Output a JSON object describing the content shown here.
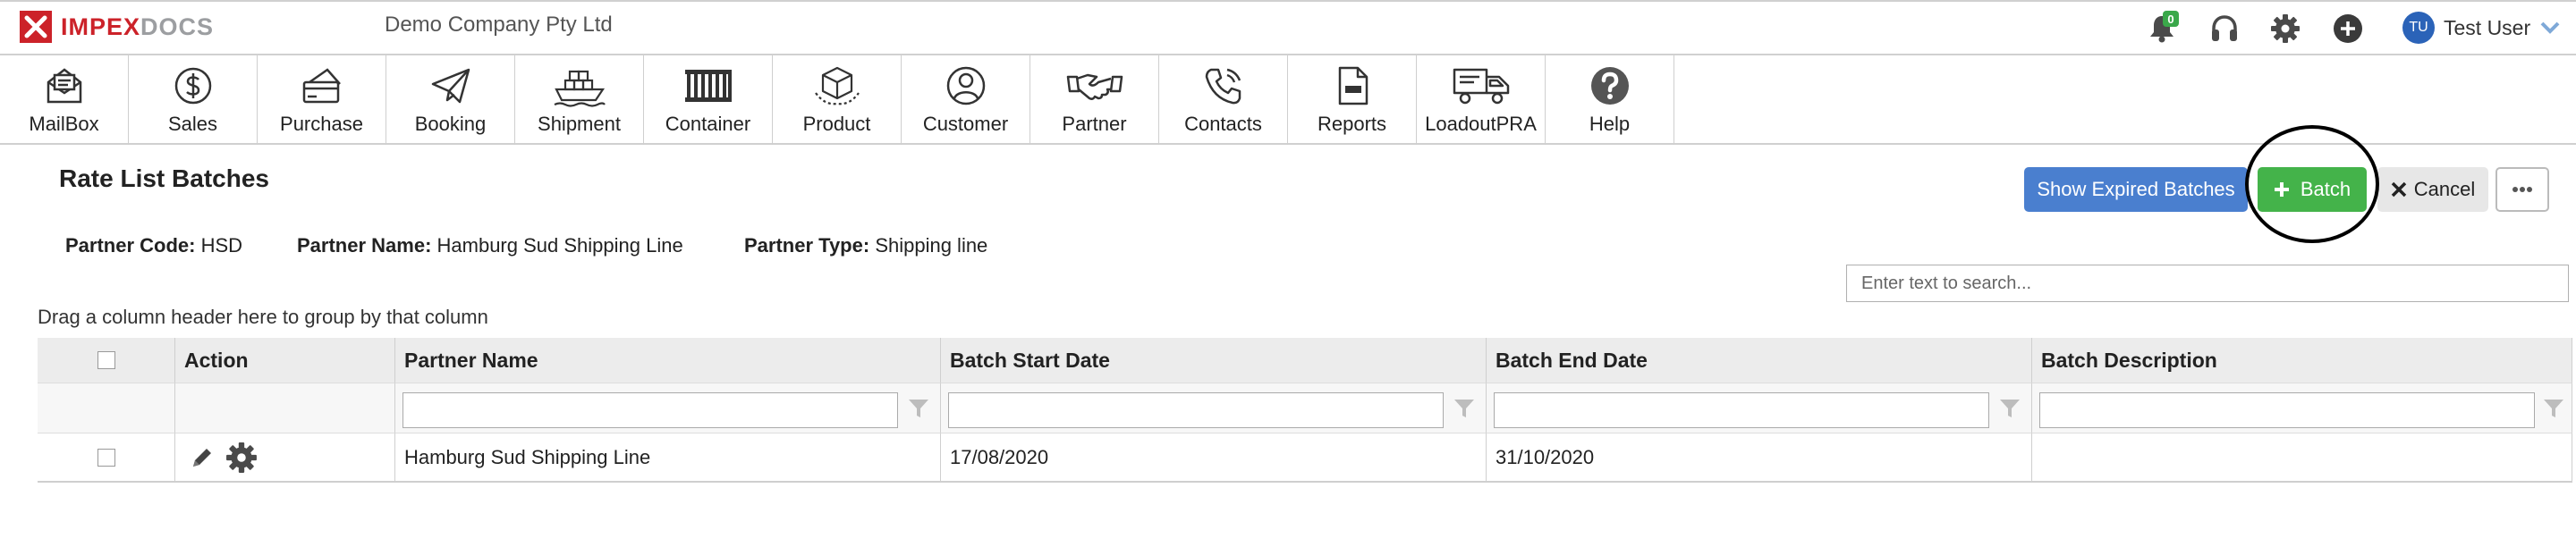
{
  "header": {
    "logo_a": "IMPEX",
    "logo_b": "DOCS",
    "company": "Demo Company Pty Ltd",
    "notification_count": "0",
    "user_initials": "TU",
    "user_name": "Test User"
  },
  "modules": [
    {
      "label": "MailBox",
      "icon": "mailbox-icon"
    },
    {
      "label": "Sales",
      "icon": "dollar-icon"
    },
    {
      "label": "Purchase",
      "icon": "purchase-icon"
    },
    {
      "label": "Booking",
      "icon": "paper-plane-icon"
    },
    {
      "label": "Shipment",
      "icon": "ship-icon"
    },
    {
      "label": "Container",
      "icon": "container-icon"
    },
    {
      "label": "Product",
      "icon": "box-icon"
    },
    {
      "label": "Customer",
      "icon": "customer-icon"
    },
    {
      "label": "Partner",
      "icon": "handshake-icon"
    },
    {
      "label": "Contacts",
      "icon": "phone-icon"
    },
    {
      "label": "Reports",
      "icon": "report-icon"
    },
    {
      "label": "LoadoutPRA",
      "icon": "truck-icon"
    },
    {
      "label": "Help",
      "icon": "help-icon"
    }
  ],
  "page": {
    "title": "Rate List Batches",
    "partner_code_label": "Partner Code:",
    "partner_code": "HSD",
    "partner_name_label": "Partner Name:",
    "partner_name": "Hamburg Sud Shipping Line",
    "partner_type_label": "Partner Type:",
    "partner_type": "Shipping line",
    "search_placeholder": "Enter text to search...",
    "group_hint": "Drag a column header here to group by that column"
  },
  "buttons": {
    "show_expired": "Show Expired Batches",
    "add_batch": "Batch",
    "cancel": "Cancel"
  },
  "grid": {
    "columns": [
      "Action",
      "Partner Name",
      "Batch Start Date",
      "Batch End Date",
      "Batch Description"
    ],
    "rows": [
      {
        "partner_name": "Hamburg Sud Shipping Line",
        "start": "17/08/2020",
        "end": "31/10/2020",
        "description": ""
      }
    ]
  },
  "colors": {
    "brand_red": "#cc2229",
    "primary_blue": "#4a7fcf",
    "success_green": "#44b34a"
  }
}
